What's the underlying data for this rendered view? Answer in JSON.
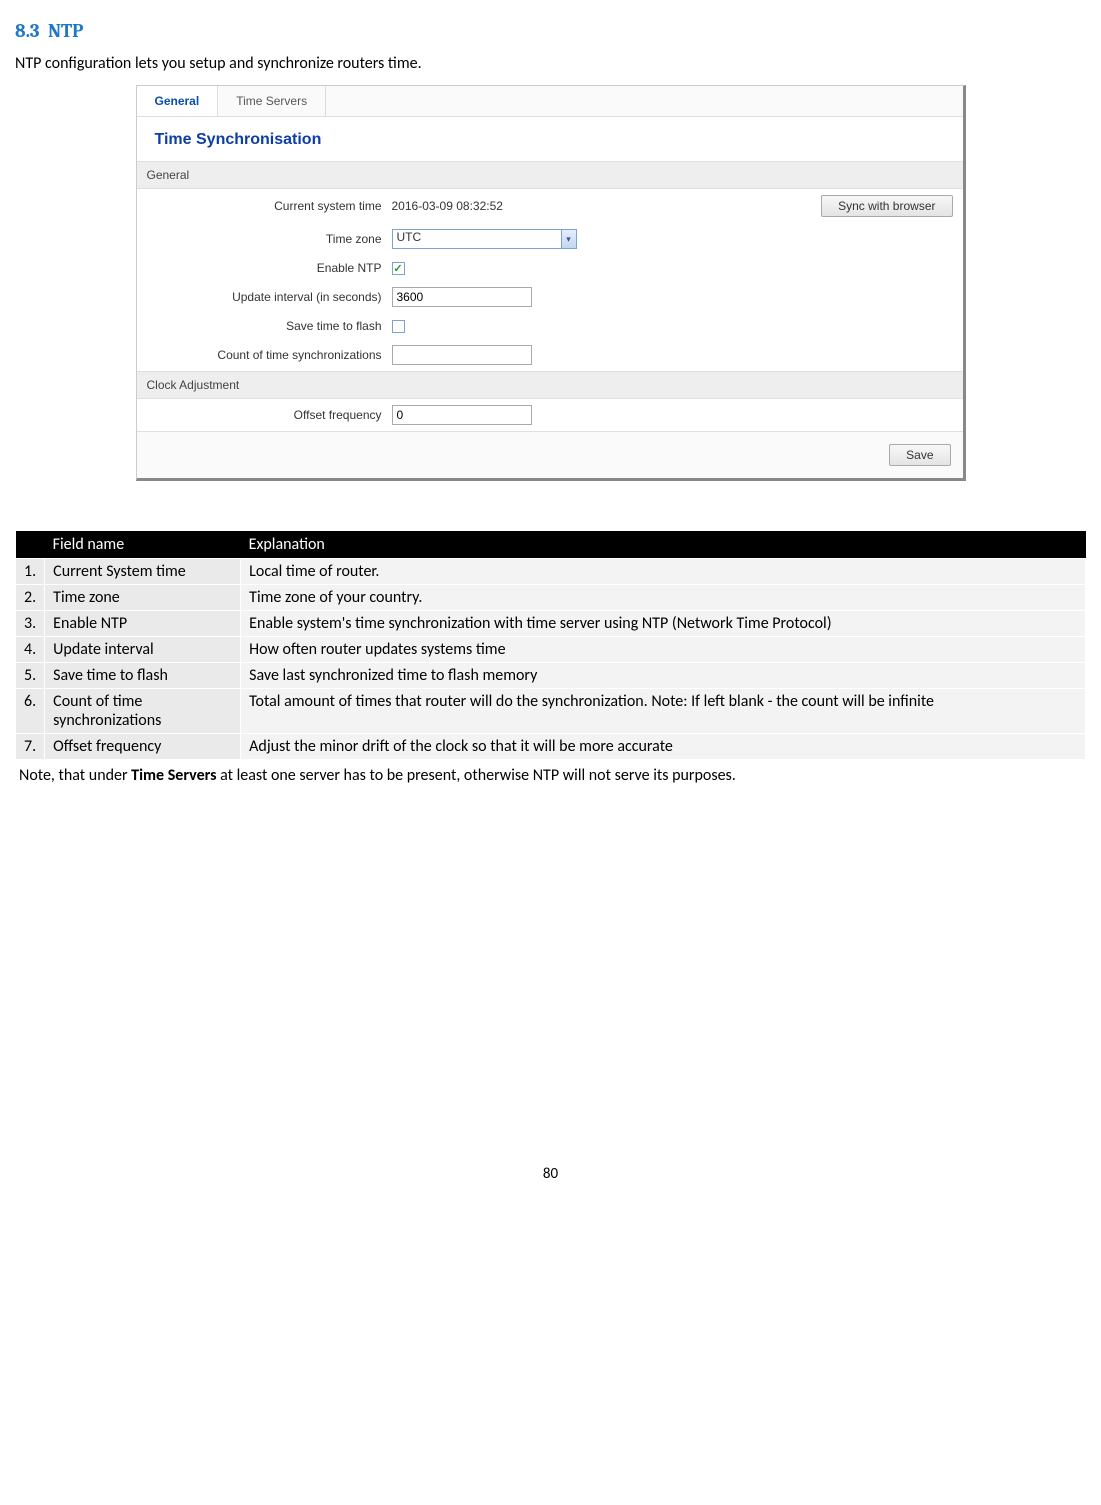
{
  "section_number": "8.3",
  "section_title": "NTP",
  "intro": "NTP configuration lets you setup and synchronize routers time.",
  "ui": {
    "tabs": {
      "general": "General",
      "time_servers": "Time Servers"
    },
    "heading": "Time Synchronisation",
    "group_general": "General",
    "group_clock": "Clock Adjustment",
    "labels": {
      "current_time": "Current system time",
      "time_zone": "Time zone",
      "enable_ntp": "Enable NTP",
      "update_interval": "Update interval (in seconds)",
      "save_flash": "Save time to flash",
      "count_sync": "Count of time synchronizations",
      "offset_freq": "Offset frequency"
    },
    "values": {
      "current_time": "2016-03-09 08:32:52",
      "time_zone": "UTC",
      "update_interval": "3600",
      "count_sync": "",
      "offset_freq": "0"
    },
    "buttons": {
      "sync": "Sync with browser",
      "save": "Save"
    }
  },
  "table": {
    "headers": {
      "num": "",
      "field": "Field name",
      "exp": "Explanation"
    },
    "rows": [
      {
        "num": "1.",
        "field": "Current System time",
        "exp": "Local time of router."
      },
      {
        "num": "2.",
        "field": "Time zone",
        "exp": "Time zone of your country."
      },
      {
        "num": "3.",
        "field": "Enable NTP",
        "exp": "Enable system's time synchronization with time server using NTP (Network Time Protocol)"
      },
      {
        "num": "4.",
        "field": "Update interval",
        "exp": "How often router updates systems time"
      },
      {
        "num": "5.",
        "field": "Save time to flash",
        "exp": "Save last synchronized time to flash memory"
      },
      {
        "num": "6.",
        "field": "Count of time synchronizations",
        "exp": "Total amount of times that router will do the synchronization. Note: If left blank - the count will be infinite"
      },
      {
        "num": "7.",
        "field": "Offset frequency",
        "exp": "Adjust the minor drift of the clock so that it will be more accurate"
      }
    ]
  },
  "note_prefix": "Note, that under ",
  "note_bold": "Time Servers",
  "note_suffix": " at least one server has to be present, otherwise NTP will not serve its purposes.",
  "page_number": "80"
}
